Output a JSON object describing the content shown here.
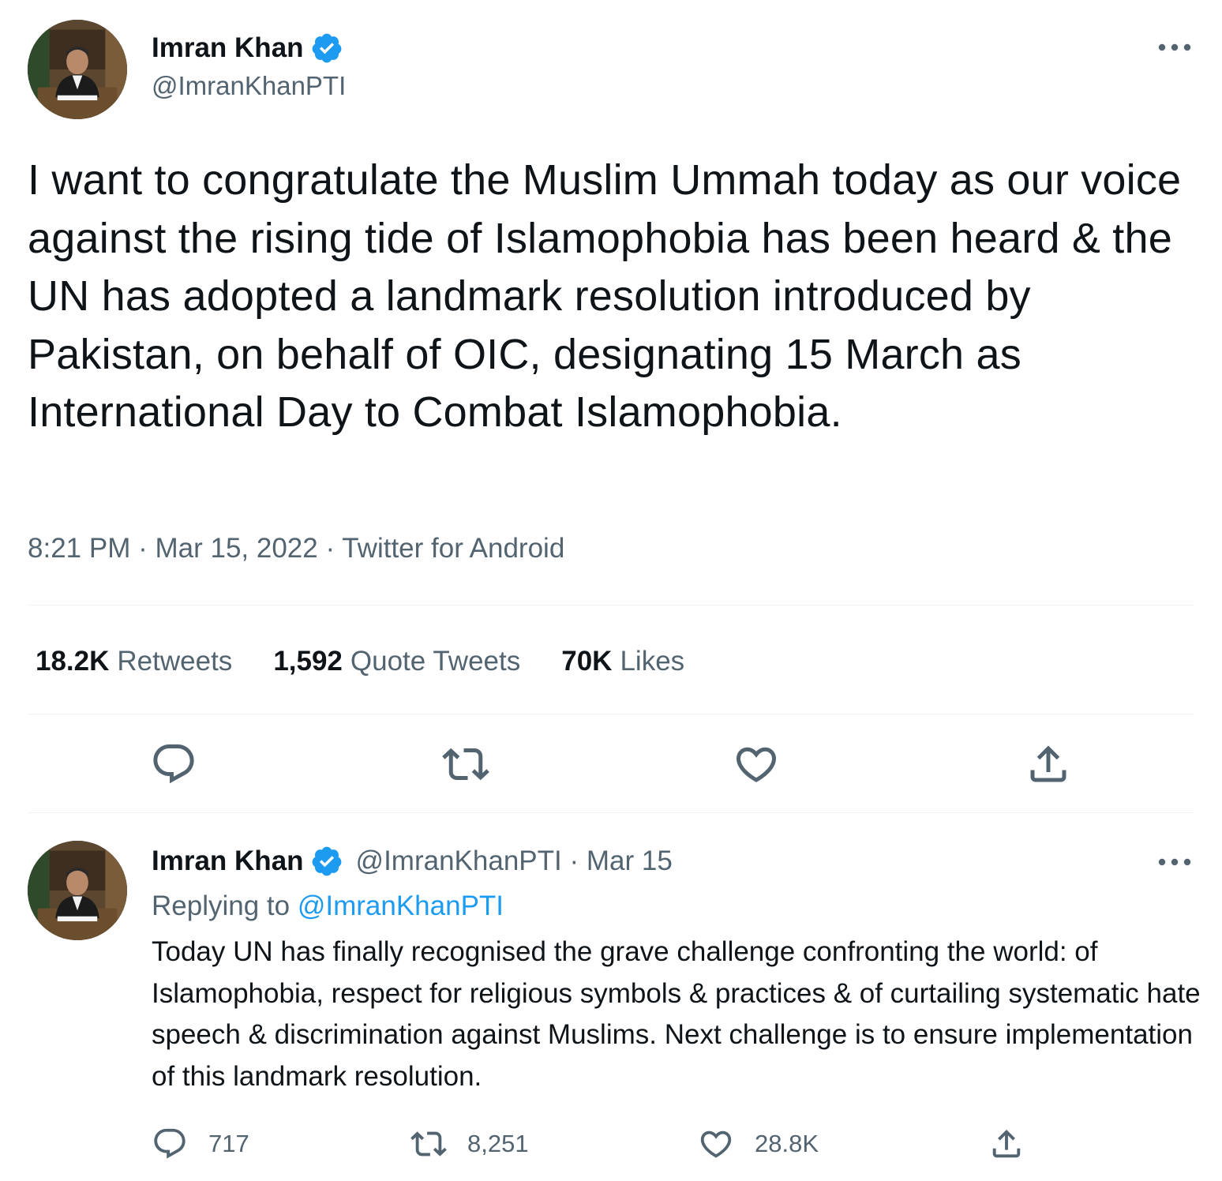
{
  "main_tweet": {
    "author_name": "Imran Khan",
    "author_handle": "@ImranKhanPTI",
    "text": "I want to congratulate the Muslim Ummah today as our voice against the rising tide of Islamophobia has been heard & the UN has adopted a landmark resolution introduced by Pakistan, on behalf of OIC, designating 15 March as International Day to Combat Islamophobia.",
    "time": "8:21 PM",
    "separator": "·",
    "date": "Mar 15, 2022",
    "source": "Twitter for Android",
    "stats": {
      "retweets_count": "18.2K",
      "retweets_label": "Retweets",
      "quotes_count": "1,592",
      "quotes_label": "Quote Tweets",
      "likes_count": "70K",
      "likes_label": "Likes"
    },
    "actions": [
      "reply-icon",
      "retweet-icon",
      "like-icon",
      "share-icon"
    ]
  },
  "reply_tweet": {
    "author_name": "Imran Khan",
    "author_handle": "@ImranKhanPTI",
    "separator": "·",
    "date": "Mar 15",
    "replying_prefix": "Replying to",
    "replying_to": "@ImranKhanPTI",
    "text": "Today UN has finally recognised the grave challenge confronting the world: of Islamophobia, respect for religious symbols & practices & of curtailing systematic hate speech & discrimination against Muslims. Next challenge is to ensure implementation of this landmark resolution.",
    "replies_count": "717",
    "retweets_count": "8,251",
    "likes_count": "28.8K"
  },
  "colors": {
    "text_primary": "#0f1419",
    "text_secondary": "#536471",
    "accent": "#1d9bf0",
    "divider": "#eff3f4"
  }
}
